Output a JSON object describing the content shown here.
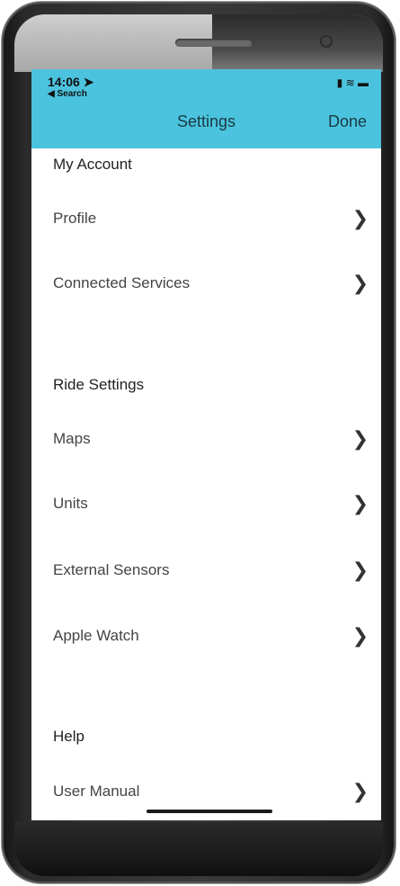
{
  "status": {
    "time": "14:06",
    "back_app": "◀ Search",
    "icons": "▪▮ ≋ ▬"
  },
  "nav": {
    "title": "Settings",
    "done_label": "Done"
  },
  "sections": {
    "my_account": "My Account",
    "ride_settings": "Ride Settings",
    "help": "Help"
  },
  "rows": {
    "profile": "Profile",
    "connected_services": "Connected Services",
    "maps": "Maps",
    "units": "Units",
    "external_sensors": "External Sensors",
    "apple_watch": "Apple Watch",
    "user_manual": "User Manual"
  },
  "colors": {
    "accent": "#4cc3de"
  }
}
